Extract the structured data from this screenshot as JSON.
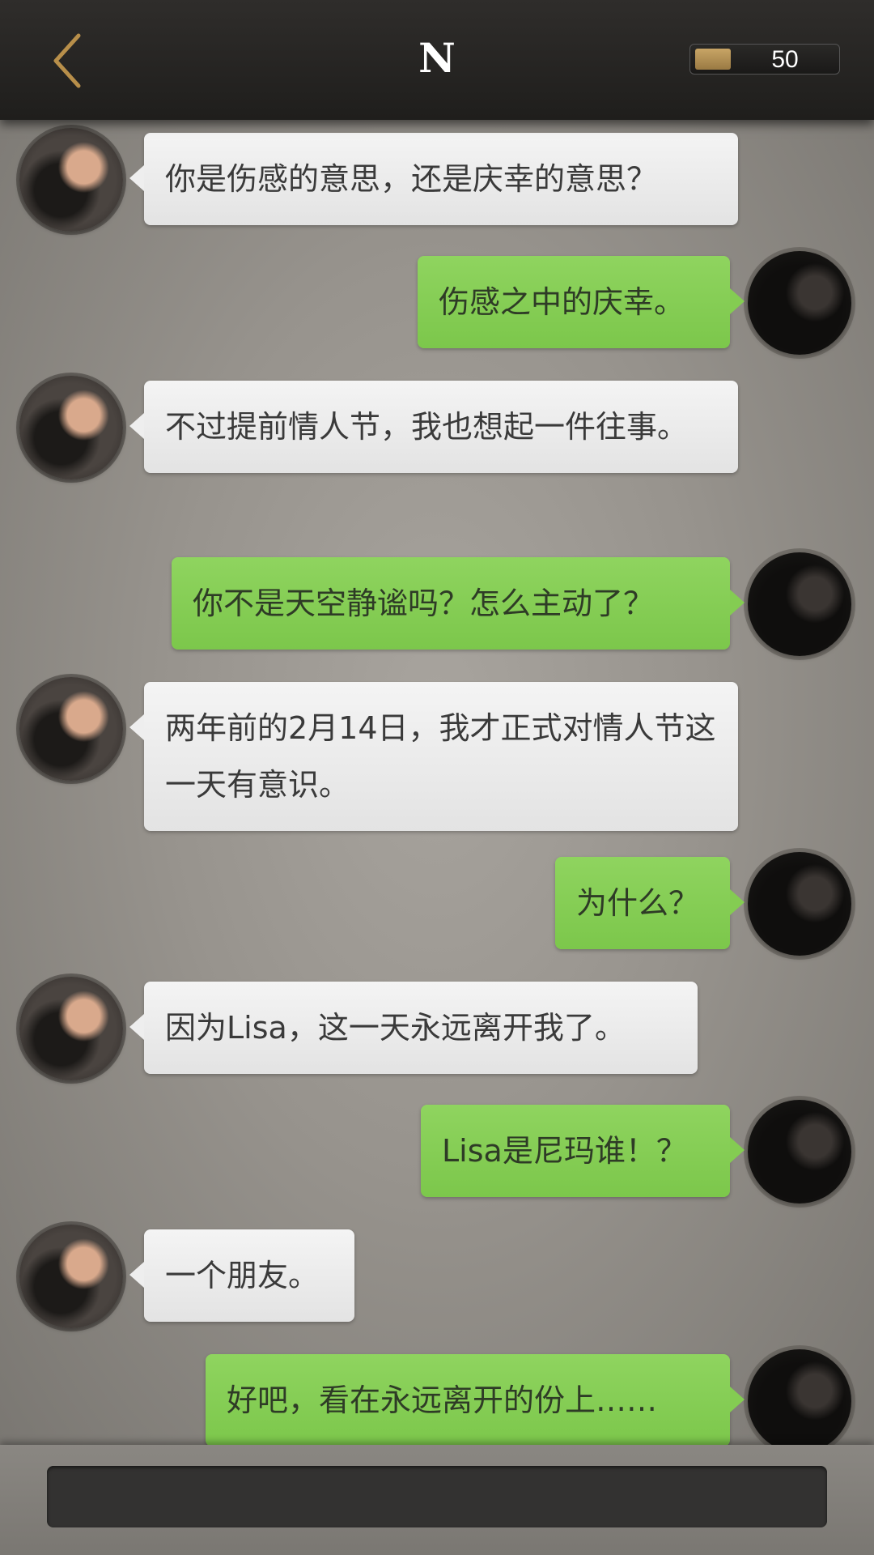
{
  "header": {
    "back_icon": "chevron-left-icon",
    "title": "N",
    "coin_icon": "gold-bar-icon",
    "coins": "50"
  },
  "messages": [
    {
      "side": "left",
      "text": "你是伤感的意思，还是庆幸的意思？"
    },
    {
      "side": "right",
      "text": "伤感之中的庆幸。"
    },
    {
      "side": "left",
      "text": "不过提前情人节，我也想起一件往事。"
    },
    {
      "side": "right",
      "text": "你不是天空静谧吗？怎么主动了？"
    },
    {
      "side": "left",
      "text": "两年前的2月14日，我才正式对情人节这一天有意识。"
    },
    {
      "side": "right",
      "text": "为什么？"
    },
    {
      "side": "left",
      "text": "因为Lisa，这一天永远离开我了。"
    },
    {
      "side": "right",
      "text": "Lisa是尼玛谁！？"
    },
    {
      "side": "left",
      "text": "一个朋友。"
    },
    {
      "side": "right",
      "text": "好吧，看在永远离开的份上……"
    }
  ],
  "input": {
    "value": ""
  },
  "colors": {
    "incoming_bubble": "#ececec",
    "outgoing_bubble": "#84cc52",
    "back_icon": "#b88f4a"
  }
}
